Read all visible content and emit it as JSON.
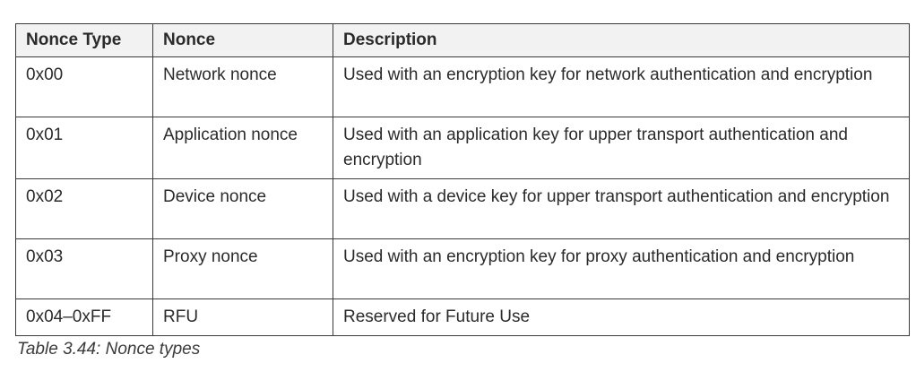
{
  "table": {
    "headers": [
      "Nonce Type",
      "Nonce",
      "Description"
    ],
    "rows": [
      [
        "0x00",
        "Network nonce",
        "Used with an encryption key for network authentication and encryption"
      ],
      [
        "0x01",
        "Application nonce",
        "Used with an application key for upper transport authentication and encryption"
      ],
      [
        "0x02",
        "Device nonce",
        "Used with a device key for upper transport authentication and encryption"
      ],
      [
        "0x03",
        "Proxy nonce",
        "Used with an encryption key for proxy authentication and encryption"
      ],
      [
        "0x04–0xFF",
        "RFU",
        "Reserved for Future Use"
      ]
    ]
  },
  "caption": "Table 3.44: Nonce types"
}
